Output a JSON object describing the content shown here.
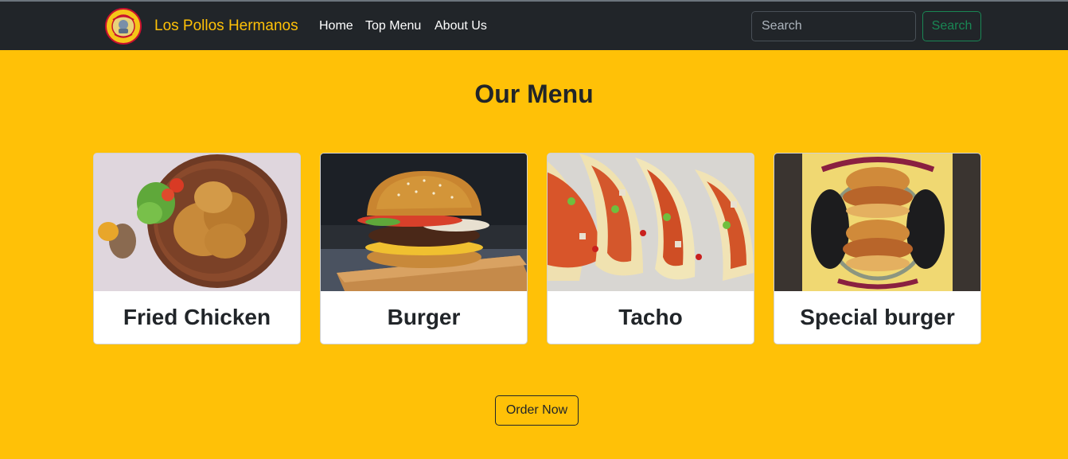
{
  "brand": {
    "name": "Los Pollos Hermanos",
    "logo_icon": "los-pollos-hermanos-logo"
  },
  "nav": {
    "links": [
      {
        "label": "Home"
      },
      {
        "label": "Top Menu"
      },
      {
        "label": "About Us"
      }
    ]
  },
  "search": {
    "placeholder": "Search",
    "button_label": "Search"
  },
  "main": {
    "title": "Our Menu",
    "cards": [
      {
        "title": "Fried Chicken",
        "image": "fried-chicken-photo"
      },
      {
        "title": "Burger",
        "image": "burger-photo"
      },
      {
        "title": "Tacho",
        "image": "tacos-photo"
      },
      {
        "title": "Special burger",
        "image": "special-burger-photo"
      }
    ],
    "order_button_label": "Order Now"
  },
  "colors": {
    "background": "#ffc107",
    "navbar": "#212529",
    "brand": "#ffc107",
    "search_button": "#198754"
  }
}
